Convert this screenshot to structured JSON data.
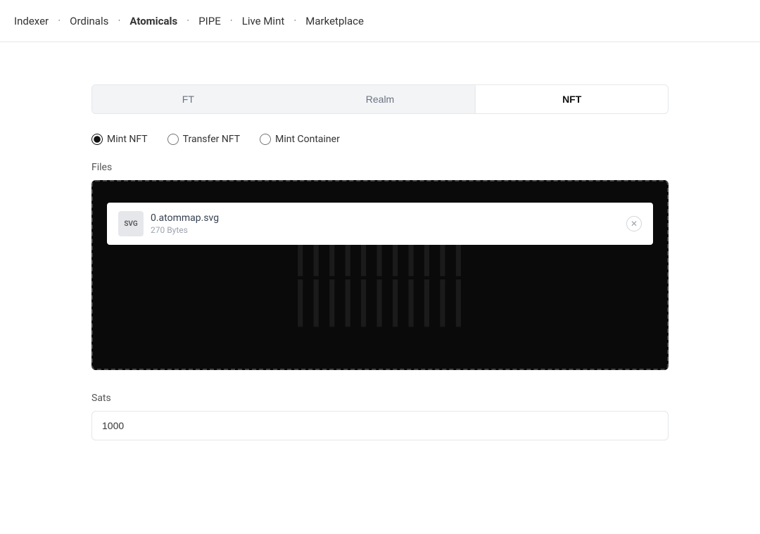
{
  "nav": {
    "items": [
      {
        "label": "Indexer",
        "active": false,
        "id": "indexer"
      },
      {
        "label": "Ordinals",
        "active": false,
        "id": "ordinals"
      },
      {
        "label": "Atomicals",
        "active": true,
        "id": "atomicals"
      },
      {
        "label": "PIPE",
        "active": false,
        "id": "pipe"
      },
      {
        "label": "Live Mint",
        "active": false,
        "id": "live-mint"
      },
      {
        "label": "Marketplace",
        "active": false,
        "id": "marketplace"
      }
    ],
    "dot": "•"
  },
  "tabs": [
    {
      "label": "FT",
      "active": false,
      "id": "ft"
    },
    {
      "label": "Realm",
      "active": false,
      "id": "realm"
    },
    {
      "label": "NFT",
      "active": true,
      "id": "nft"
    }
  ],
  "radio_options": [
    {
      "label": "Mint NFT",
      "value": "mint-nft",
      "checked": true
    },
    {
      "label": "Transfer NFT",
      "value": "transfer-nft",
      "checked": false
    },
    {
      "label": "Mint Container",
      "value": "mint-container",
      "checked": false
    }
  ],
  "files_label": "Files",
  "file": {
    "name": "0.atommap.svg",
    "size": "270 Bytes",
    "icon_text": "SVG"
  },
  "watermark": "|||||||||||",
  "sats_label": "Sats",
  "sats_value": "1000",
  "sats_placeholder": "1000"
}
